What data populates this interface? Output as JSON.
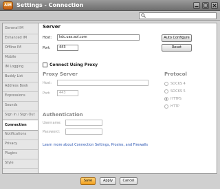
{
  "window": {
    "title": "Settings - Connection",
    "logo_text": "AIM",
    "accent": "#e8892a"
  },
  "search": {
    "value": "",
    "placeholder": ""
  },
  "sidebar": {
    "items": [
      {
        "label": "General IM"
      },
      {
        "label": "Enhanced IM"
      },
      {
        "label": "Offline IM"
      },
      {
        "label": "Mobile"
      },
      {
        "label": "IM Logging"
      },
      {
        "label": "Buddy List"
      },
      {
        "label": "Address Book"
      },
      {
        "label": "Expressions"
      },
      {
        "label": "Sounds"
      },
      {
        "label": "Sign In / Sign Out"
      },
      {
        "label": "Connection",
        "active": true
      },
      {
        "label": "Notifications"
      },
      {
        "label": "Privacy"
      },
      {
        "label": "Plugins"
      },
      {
        "label": "Style"
      }
    ]
  },
  "server": {
    "heading": "Server",
    "host_label": "Host:",
    "host_value": "kdc.uas.aol.com",
    "port_label": "Port:",
    "port_value": "443",
    "auto_configure_label": "Auto Configure",
    "reset_label": "Reset"
  },
  "proxy": {
    "checkbox_label": "Connect Using Proxy",
    "checked": false,
    "heading": "Proxy Server",
    "host_label": "Host:",
    "host_value": "",
    "port_label": "Port:",
    "port_value": "443"
  },
  "protocol": {
    "heading": "Protocol",
    "options": [
      {
        "label": "SOCKS 4",
        "selected": false
      },
      {
        "label": "SOCKS 5",
        "selected": false
      },
      {
        "label": "HTTPS",
        "selected": true
      },
      {
        "label": "HTTP",
        "selected": false
      }
    ]
  },
  "auth": {
    "heading": "Authentication",
    "username_label": "Username:",
    "username_value": "",
    "password_label": "Password:",
    "password_value": ""
  },
  "learn_more_link": "Learn more about Connection Settings, Proxies, and Firewalls",
  "footer": {
    "save_label": "Save",
    "apply_label": "Apply",
    "cancel_label": "Cancel"
  }
}
